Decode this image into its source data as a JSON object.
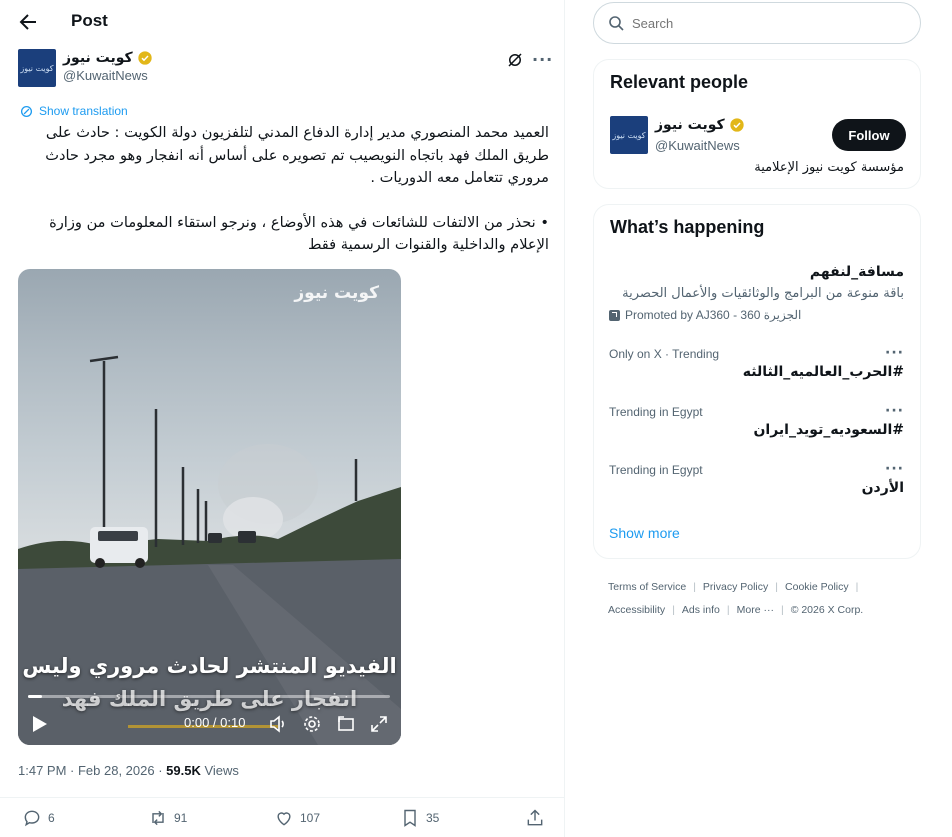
{
  "header": {
    "title": "Post"
  },
  "post": {
    "author_name": "كويت نيوز",
    "author_handle": "@KuwaitNews",
    "avatar_text": "كويت نيوز",
    "show_translation": "Show translation",
    "paragraphs": [
      "العميد محمد المنصوري مدير إدارة الدفاع المدني لتلفزيون دولة الكويت : حادث على طريق الملك فهد باتجاه النويصيب تم تصويره على أساس أنه انفجار وهو مجرد حادث مروري تتعامل معه الدوريات .",
      "• نحذر من الالتفات للشائعات في هذه الأوضاع ، ونرجو استقاء المعلومات من وزارة الإعلام والداخلية والقنوات الرسمية فقط"
    ],
    "video": {
      "brand": "كويت نيوز",
      "caption_line1": "الفيديو المنتشر لحادث مروري وليس",
      "caption_line2": "انفجار على طريق الملك فهد",
      "time": "0:00 / 0:10",
      "progress": 0.04
    },
    "timestamp": "1:47 PM · Feb 28, 2026 · ",
    "views_count": "59.5K",
    "views_label": " Views",
    "actions": {
      "replies": "6",
      "reposts": "91",
      "likes": "107",
      "bookmarks": "35"
    }
  },
  "search": {
    "placeholder": "Search"
  },
  "relevant_people": {
    "title": "Relevant people",
    "name": "كويت نيوز",
    "handle": "@KuwaitNews",
    "follow_label": "Follow",
    "bio": "مؤسسة كويت نيوز الإعلامية"
  },
  "whats_happening": {
    "title": "What’s happening",
    "promoted": {
      "title": "مسافة_لنفهم",
      "description": "باقة منوعة من البرامج والوثائقيات والأعمال الحصرية",
      "promo_label": "Promoted by AJ360 - الجزيرة 360"
    },
    "trends": [
      {
        "context": "Only on X · Trending",
        "title": "#الحرب_العالميه_الثالثه"
      },
      {
        "context": "Trending in Egypt",
        "title": "#السعوديه_تويد_ايران"
      },
      {
        "context": "Trending in Egypt",
        "title": "الأردن"
      }
    ],
    "show_more": "Show more"
  },
  "footer": {
    "terms": "Terms of Service",
    "privacy": "Privacy Policy",
    "cookie": "Cookie Policy",
    "accessibility": "Accessibility",
    "ads": "Ads info",
    "more": "More ···",
    "copyright": "© 2026 X Corp."
  },
  "colors": {
    "accent": "#1d9bf0",
    "text": "#0f1419",
    "muted": "#536471",
    "avatar_bg": "#1b3f7c",
    "verified": "#e2b719"
  }
}
